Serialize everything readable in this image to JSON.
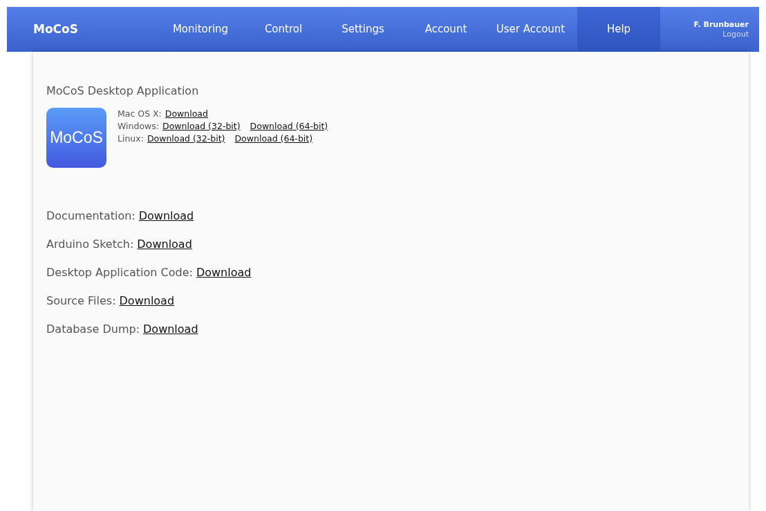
{
  "navbar": {
    "brand": "MoCoS",
    "items": [
      {
        "label": "Monitoring",
        "selected": false
      },
      {
        "label": "Control",
        "selected": false
      },
      {
        "label": "Settings",
        "selected": false
      },
      {
        "label": "Account",
        "selected": false
      },
      {
        "label": "User Account",
        "selected": false
      },
      {
        "label": "Help",
        "selected": true
      }
    ],
    "user": {
      "name": "F. Brunbauer",
      "logout": "Logout"
    }
  },
  "desktop_app": {
    "title": "MoCoS Desktop Application",
    "icon_label": "MoCoS",
    "platforms": [
      {
        "label": "Mac OS X:",
        "links": [
          "Download"
        ]
      },
      {
        "label": "Windows:",
        "links": [
          "Download (32-bit)",
          "Download (64-bit)"
        ]
      },
      {
        "label": "Linux:",
        "links": [
          "Download (32-bit)",
          "Download (64-bit)"
        ]
      }
    ]
  },
  "downloads": [
    {
      "label": "Documentation:",
      "link": "Download"
    },
    {
      "label": "Arduino Sketch:",
      "link": "Download"
    },
    {
      "label": "Desktop Application Code:",
      "link": "Download"
    },
    {
      "label": "Source Files:",
      "link": "Download"
    },
    {
      "label": "Database Dump:",
      "link": "Download"
    }
  ]
}
